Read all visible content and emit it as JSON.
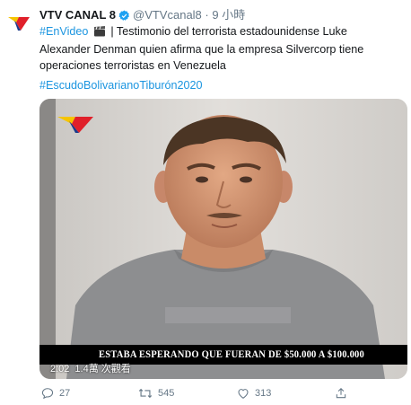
{
  "tweet": {
    "display_name": "VTV CANAL 8",
    "handle": "@VTVcanal8",
    "separator": "·",
    "time": "9 小時",
    "hashtag_envideo": "#EnVideo",
    "body_text": "| Testimonio del terrorista estadounidense Luke Alexander Denman quien afirma que la empresa Silvercorp tiene operaciones terroristas en Venezuela",
    "hashtag_line": "#EscudoBolivarianoTiburón2020"
  },
  "video": {
    "caption": "ESTABA ESPERANDO QUE FUERAN DE $50.000 A $100.000",
    "duration": "2:02",
    "views": "1.4萬 次觀看"
  },
  "actions": {
    "reply_count": "27",
    "retweet_count": "545",
    "like_count": "313"
  },
  "colors": {
    "link": "#1b95e0",
    "muted": "#657786",
    "verified": "#1da1f2",
    "logo_yellow": "#f5c400",
    "logo_red": "#e0202a"
  },
  "icons": {
    "avatar": "vtv-logo",
    "verified": "verified-badge-icon",
    "clapper": "clapper-board-icon",
    "reply": "reply-icon",
    "retweet": "retweet-icon",
    "like": "heart-icon",
    "share": "share-icon"
  }
}
